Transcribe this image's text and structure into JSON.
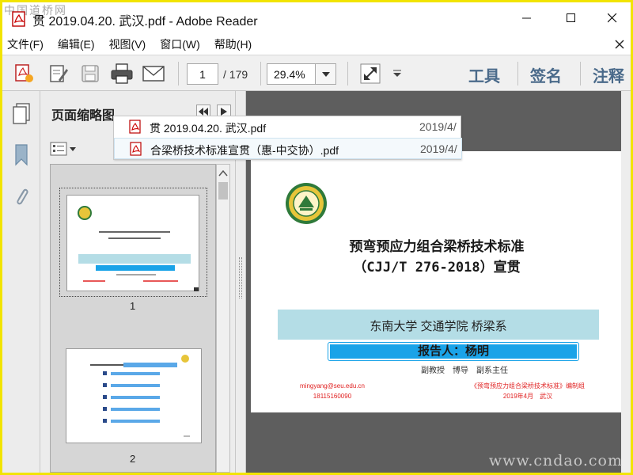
{
  "watermark_top": "中国道桥网",
  "watermark_bottom": "www.cndao.com",
  "window": {
    "title": "贯 2019.04.20. 武汉.pdf - Adobe Reader"
  },
  "menu": {
    "items": [
      "文件(F)",
      "编辑(E)",
      "视图(V)",
      "窗口(W)",
      "帮助(H)"
    ]
  },
  "toolbar": {
    "page_current": "1",
    "page_total": "/ 179",
    "zoom": "29.4%",
    "tools": "工具",
    "sign": "签名",
    "comment": "注释"
  },
  "nav": {
    "panel_title": "页面缩略图",
    "thumbnail_labels": [
      "1",
      "2"
    ]
  },
  "recent_files": [
    {
      "name": "贯 2019.04.20. 武汉.pdf",
      "date": "2019/4/"
    },
    {
      "name": "合梁桥技术标准宣贯（惠-中交协）.pdf",
      "date": "2019/4/"
    }
  ],
  "document": {
    "title_line1": "预弯预应力组合梁桥技术标准",
    "title_line2": "（CJJ/T 276-2018）宣贯",
    "affiliation": "东南大学 交通学院 桥梁系",
    "reporter": "报告人：杨明",
    "positions": "副教授　博导　副系主任",
    "email": "mingyang@seu.edu.cn",
    "phone": "18115160090",
    "committee": "《预弯预应力组合梁桥技术标准》编制组",
    "date": "2019年4月　武汉"
  },
  "colors": {
    "accent_blue": "#1aa3e8",
    "band": "#b4dde6",
    "toolbar_right_text": "#4a6a8a",
    "doc_background": "#5e5e5e",
    "red_text": "#e02020"
  }
}
